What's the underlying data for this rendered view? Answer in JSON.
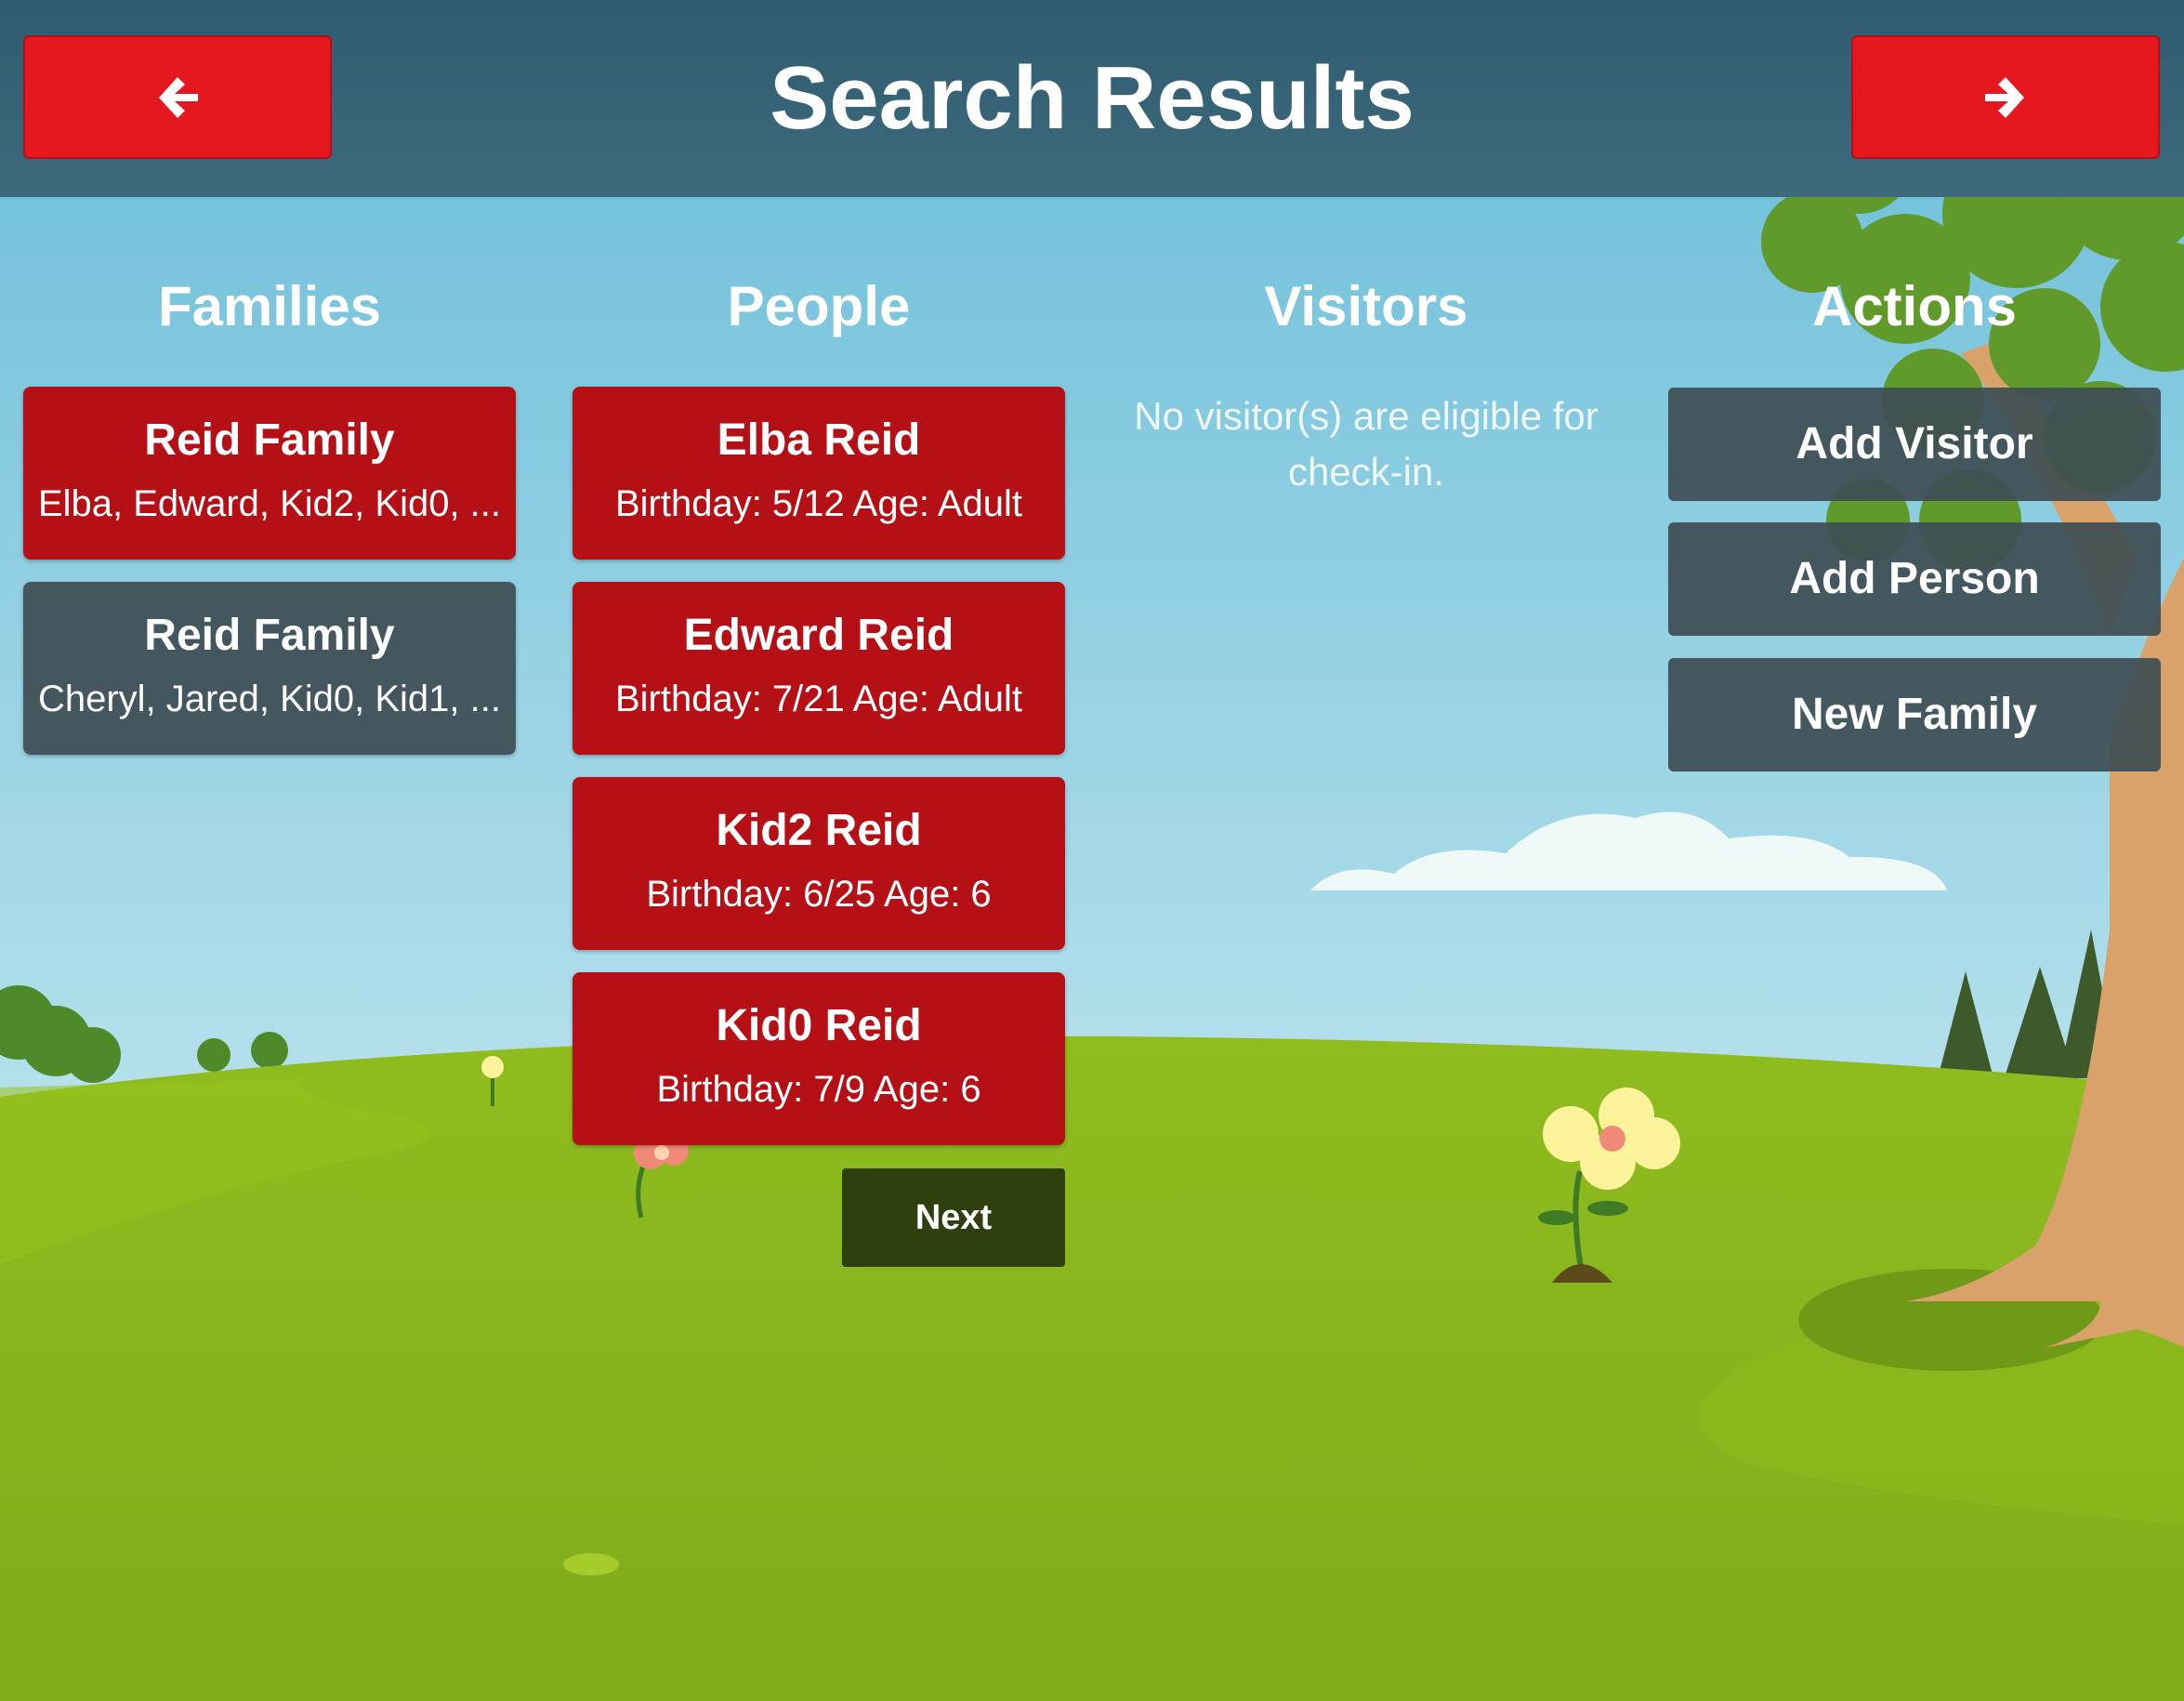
{
  "header": {
    "title": "Search Results",
    "back_icon": "arrow-left-icon",
    "forward_icon": "arrow-right-icon",
    "button_color": "#e5171f"
  },
  "columns": {
    "families": "Families",
    "people": "People",
    "visitors": "Visitors",
    "actions": "Actions"
  },
  "families": [
    {
      "name": "Reid Family",
      "members": "Elba, Edward, Kid2, Kid0, ...",
      "selected": true
    },
    {
      "name": "Reid Family",
      "members": "Cheryl, Jared, Kid0, Kid1, ...",
      "selected": false
    }
  ],
  "people": [
    {
      "name": "Elba Reid",
      "details": "Birthday: 5/12 Age: Adult"
    },
    {
      "name": "Edward Reid",
      "details": "Birthday: 7/21 Age: Adult"
    },
    {
      "name": "Kid2 Reid",
      "details": "Birthday: 6/25 Age: 6"
    },
    {
      "name": "Kid0 Reid",
      "details": "Birthday: 7/9 Age: 6"
    }
  ],
  "people_next": "Next",
  "visitors": {
    "message_line1": "No visitor(s) are eligible for",
    "message_line2": "check-in."
  },
  "actions": {
    "add_visitor": "Add Visitor",
    "add_person": "Add Person",
    "new_family": "New Family"
  },
  "colors": {
    "accent_red": "#b51016",
    "slate": "#3e4d54",
    "header": "#2f5b70",
    "grass": "#85b11c",
    "next_button": "#2f3f0d"
  }
}
